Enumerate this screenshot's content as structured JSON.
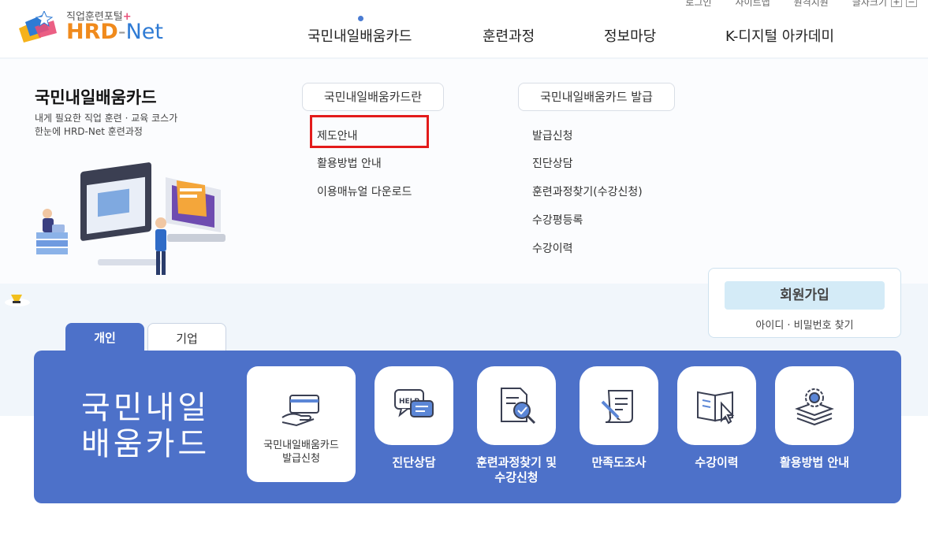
{
  "logo": {
    "subtitle": "직업훈련포털",
    "brand_main": "HRD",
    "brand_dash": "-",
    "brand_net": "Net"
  },
  "utility": {
    "login": "로그인",
    "sitemap": "사이트맵",
    "remote": "원격지원",
    "fontsize": "글자크기",
    "plus": "+",
    "minus": "−"
  },
  "gnb": [
    {
      "label": "국민내일배움카드"
    },
    {
      "label": "훈련과정"
    },
    {
      "label": "정보마당"
    },
    {
      "label": "K-디지털 아카데미"
    }
  ],
  "mega": {
    "title": "국민내일배움카드",
    "desc_line1": "내게 필요한 직업 훈련 · 교육 코스가",
    "desc_line2": "한눈에 HRD-Net 훈련과정",
    "col1": {
      "heading": "국민내일배움카드란",
      "links": [
        "제도안내",
        "활용방법 안내",
        "이용매뉴얼 다운로드"
      ]
    },
    "col2": {
      "heading": "국민내일배움카드 발급",
      "links": [
        "발급신청",
        "진단상담",
        "훈련과정찾기(수강신청)",
        "수강평등록",
        "수강이력"
      ]
    }
  },
  "login_box": {
    "join": "회원가입",
    "find": "아이디 · 비밀번호 찾기"
  },
  "tabs": {
    "personal": "개인",
    "company": "기업"
  },
  "panel": {
    "title_line1": "국민내일",
    "title_line2": "배움카드",
    "services": [
      {
        "line1": "국민내일배움카드",
        "line2": "발급신청",
        "icon": "card-hand-icon"
      },
      {
        "line1": "진단상담",
        "line2": "",
        "icon": "help-chat-icon"
      },
      {
        "line1": "훈련과정찾기 및",
        "line2": "수강신청",
        "icon": "document-search-icon"
      },
      {
        "line1": "만족도조사",
        "line2": "",
        "icon": "survey-scroll-icon"
      },
      {
        "line1": "수강이력",
        "line2": "",
        "icon": "book-cursor-icon"
      },
      {
        "line1": "활용방법 안내",
        "line2": "",
        "icon": "gear-stack-icon"
      }
    ]
  },
  "colors": {
    "accent_blue": "#4d71c9",
    "brand_orange": "#f08a1c",
    "brand_blue": "#2f7bd4",
    "highlight_red": "#e31b1b"
  }
}
